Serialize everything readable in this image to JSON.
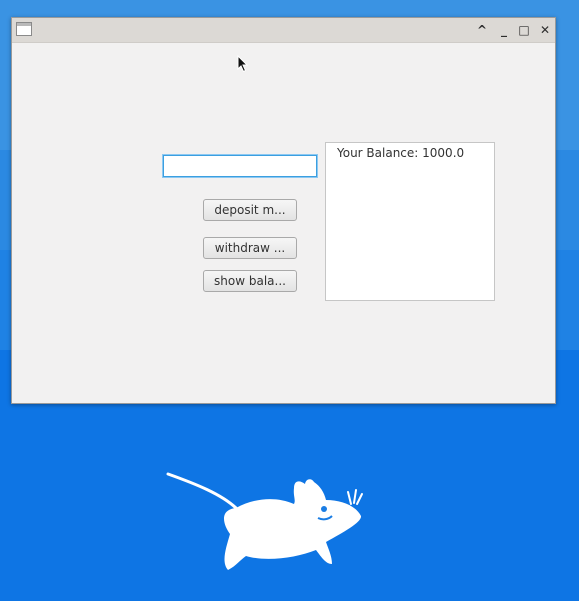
{
  "window": {
    "title": "",
    "controls": {
      "minimize_left": "^",
      "minimize": "_",
      "maximize": "□",
      "close": "✕"
    }
  },
  "form": {
    "amount_input": {
      "value": "",
      "placeholder": ""
    },
    "buttons": {
      "deposit": "deposit m...",
      "withdraw": "withdraw ...",
      "show_balance": "show bala..."
    },
    "output": "Your Balance: 1000.0"
  },
  "desktop": {
    "background_color": "#1c80e3",
    "logo": "xfce-mouse-icon"
  }
}
